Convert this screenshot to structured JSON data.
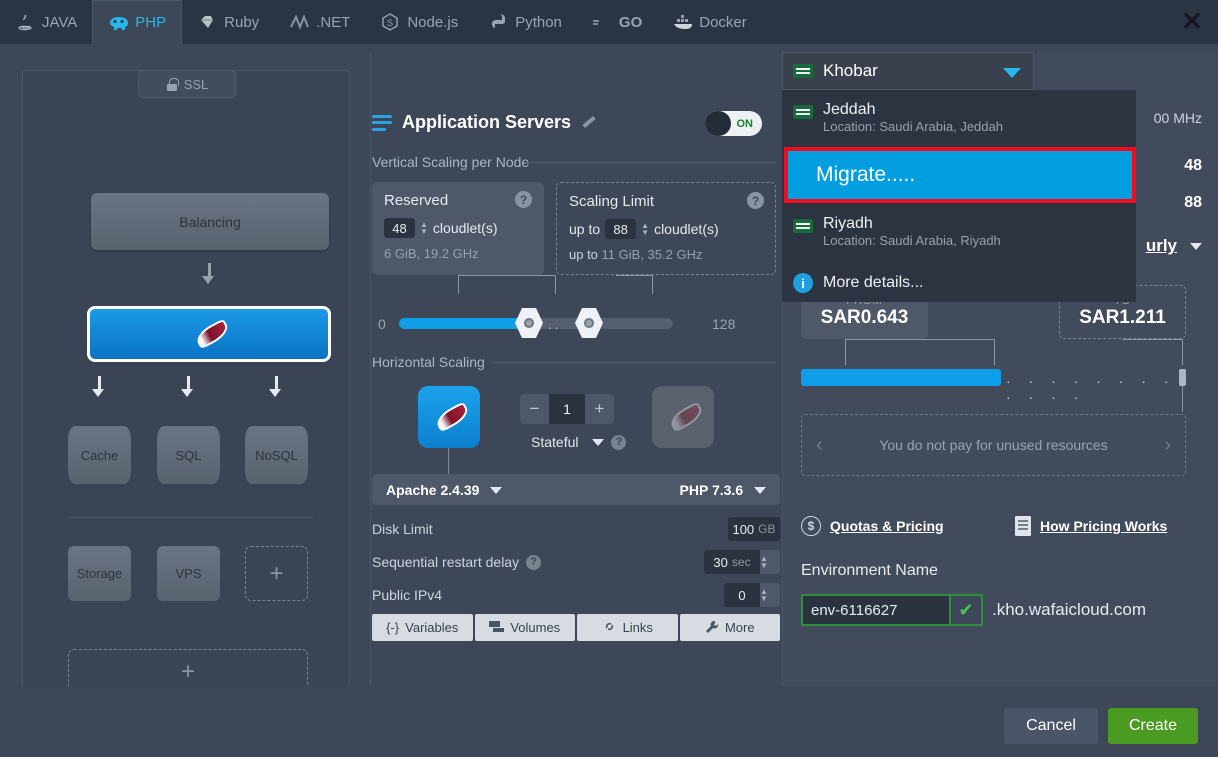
{
  "tabs": [
    {
      "label": "JAVA",
      "icon": "java-icon",
      "active": false
    },
    {
      "label": "PHP",
      "icon": "php-elephant-icon",
      "active": true
    },
    {
      "label": "Ruby",
      "icon": "ruby-gem-icon",
      "active": false
    },
    {
      "label": ".NET",
      "icon": "dotnet-icon",
      "active": false
    },
    {
      "label": "Node.js",
      "icon": "nodejs-icon",
      "active": false
    },
    {
      "label": "Python",
      "icon": "python-icon",
      "active": false
    },
    {
      "label": "GO",
      "icon": "go-icon",
      "active": false
    },
    {
      "label": "Docker",
      "icon": "docker-whale-icon",
      "active": false
    }
  ],
  "window": {
    "close_label": "✕"
  },
  "topology": {
    "ssl_label": "SSL",
    "balancing_label": "Balancing",
    "app_server_icon": "apache-feather-icon",
    "db_nodes": [
      "Cache",
      "SQL",
      "NoSQL"
    ],
    "extra_nodes": [
      "Storage",
      "VPS"
    ],
    "add_label": "+"
  },
  "center": {
    "title": "Application Servers",
    "edit_icon": "pencil-icon",
    "toggle_state": "ON",
    "vertical_section_label": "Vertical Scaling per Node",
    "reserved": {
      "title": "Reserved",
      "value": "48",
      "unit": "cloudlet(s)",
      "detail": "6 GiB, 19.2 GHz",
      "help": "?"
    },
    "scaling_limit": {
      "title": "Scaling Limit",
      "prefix": "up to",
      "value": "88",
      "unit": "cloudlet(s)",
      "detail_prefix": "up to",
      "detail": "11 GiB, 35.2 GHz",
      "help": "?"
    },
    "slider": {
      "min": "0",
      "max": "128",
      "dots": "··"
    },
    "horizontal_section_label": "Horizontal Scaling",
    "node_count": "1",
    "minus": "−",
    "plus": "+",
    "stateful_label": "Stateful",
    "stateful_help": "?",
    "engine": "Apache 2.4.39",
    "runtime": "PHP 7.3.6",
    "disk_limit_label": "Disk Limit",
    "disk_limit_value": "100",
    "disk_limit_unit": "GB",
    "restart_label": "Sequential restart delay",
    "restart_help": "?",
    "restart_value": "30",
    "restart_unit": "sec",
    "ipv4_label": "Public IPv4",
    "ipv4_value": "0",
    "buttons": [
      {
        "label": "Variables",
        "icon": "braces-icon"
      },
      {
        "label": "Volumes",
        "icon": "volumes-icon"
      },
      {
        "label": "Links",
        "icon": "chain-link-icon"
      },
      {
        "label": "More",
        "icon": "wrench-icon"
      }
    ]
  },
  "right": {
    "hidden_mhz": "00 MHz",
    "reserved_num": "48",
    "limit_num": "88",
    "period": "urly",
    "from_label": "FROM",
    "from_price": "SAR0.643",
    "to_label": "TO",
    "to_price": "SAR1.211",
    "unused_note": "You do not pay for unused resources",
    "prev_chev": "‹",
    "next_chev": "›",
    "quotas_link": "Quotas & Pricing",
    "quotas_icon": "dollar-circle-icon",
    "pricing_link": "How Pricing Works",
    "pricing_icon": "document-icon",
    "env_name_label": "Environment Name",
    "env_name_value": "env-6116627",
    "env_check": "✔",
    "env_domain": ".kho.wafaicloud.com"
  },
  "dropdown": {
    "selected": "Khobar",
    "caret_icon": "chevron-down-icon",
    "options": [
      {
        "name": "Jeddah",
        "location": "Location: Saudi Arabia, Jeddah",
        "icon": "saudi-flag-icon"
      },
      {
        "name": "Riyadh",
        "location": "Location: Saudi Arabia, Riyadh",
        "icon": "saudi-flag-icon"
      }
    ],
    "highlighted_option": "Migrate.....",
    "more_details": "More details...",
    "more_details_icon": "info-icon"
  },
  "footer": {
    "cancel_label": "Cancel",
    "create_label": "Create"
  },
  "colors": {
    "accent_blue": "#029ee0",
    "highlight_border_red": "#f10c1e",
    "create_green": "#4b9b22",
    "env_valid_green": "#2f8f3c",
    "panel_bg": "#3d4757"
  }
}
